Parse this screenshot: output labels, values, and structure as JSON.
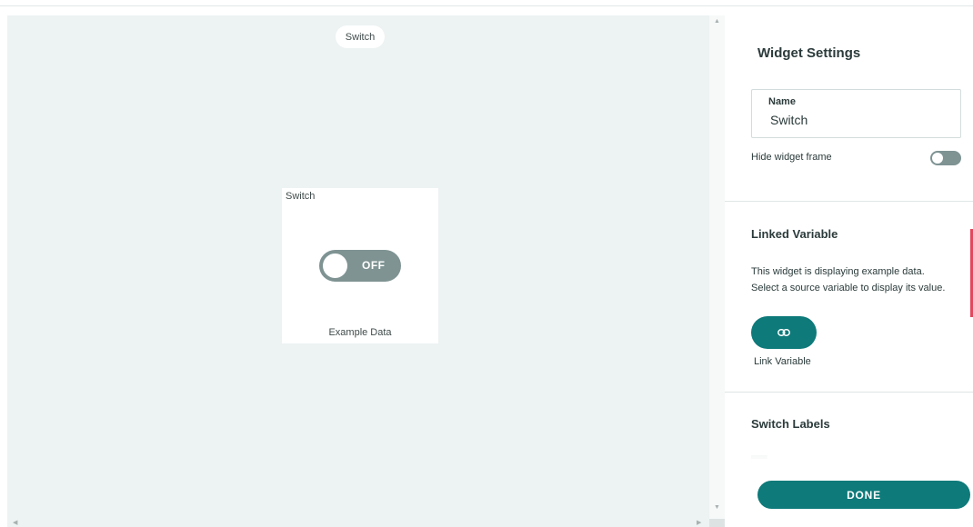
{
  "canvas": {
    "page_chip_label": "Switch"
  },
  "widget": {
    "title": "Switch",
    "toggle_state": "OFF",
    "footer_label": "Example Data"
  },
  "settings_panel": {
    "title": "Widget Settings",
    "name_label": "Name",
    "name_value": "Switch",
    "hide_frame_label": "Hide widget frame",
    "hide_frame_enabled": false,
    "linked_variable": {
      "title": "Linked Variable",
      "description_line1": "This widget is displaying example data.",
      "description_line2": "Select a source variable to display its value.",
      "button_icon": "link-icon",
      "button_label": "Link Variable"
    },
    "switch_labels": {
      "title": "Switch Labels"
    },
    "done_label": "DONE"
  },
  "colors": {
    "accent": "#0e7a7a",
    "toggle_off": "#7f9393",
    "canvas_bg": "#edf2f2",
    "alert": "#e4475d"
  }
}
